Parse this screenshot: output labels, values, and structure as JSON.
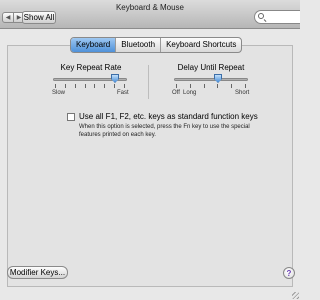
{
  "window": {
    "title": "Keyboard & Mouse"
  },
  "toolbar": {
    "back_glyph": "◀",
    "forward_glyph": "▶",
    "show_all_label": "Show All"
  },
  "tabs": [
    {
      "label": "Keyboard",
      "selected": true
    },
    {
      "label": "Bluetooth",
      "selected": false
    },
    {
      "label": "Keyboard Shortcuts",
      "selected": false
    }
  ],
  "key_repeat": {
    "heading": "Key Repeat Rate",
    "left_label": "Slow",
    "right_label": "Fast",
    "value": 0.85
  },
  "delay": {
    "heading": "Delay Until Repeat",
    "left_label": "Off",
    "mid_label": "Long",
    "right_label": "Short",
    "value": 0.6
  },
  "function_keys": {
    "label": "Use all F1, F2, etc. keys as standard function keys",
    "note": "When this option is selected, press the Fn key to use the special features printed on each key.",
    "checked": false
  },
  "footer": {
    "modifier_keys_label": "Modifier Keys...",
    "help_glyph": "?"
  },
  "colors": {
    "accent": "#4f91d9",
    "help": "#6a3fb5"
  },
  "icons": [
    "back-arrow-icon",
    "forward-arrow-icon",
    "search-icon",
    "help-icon"
  ]
}
